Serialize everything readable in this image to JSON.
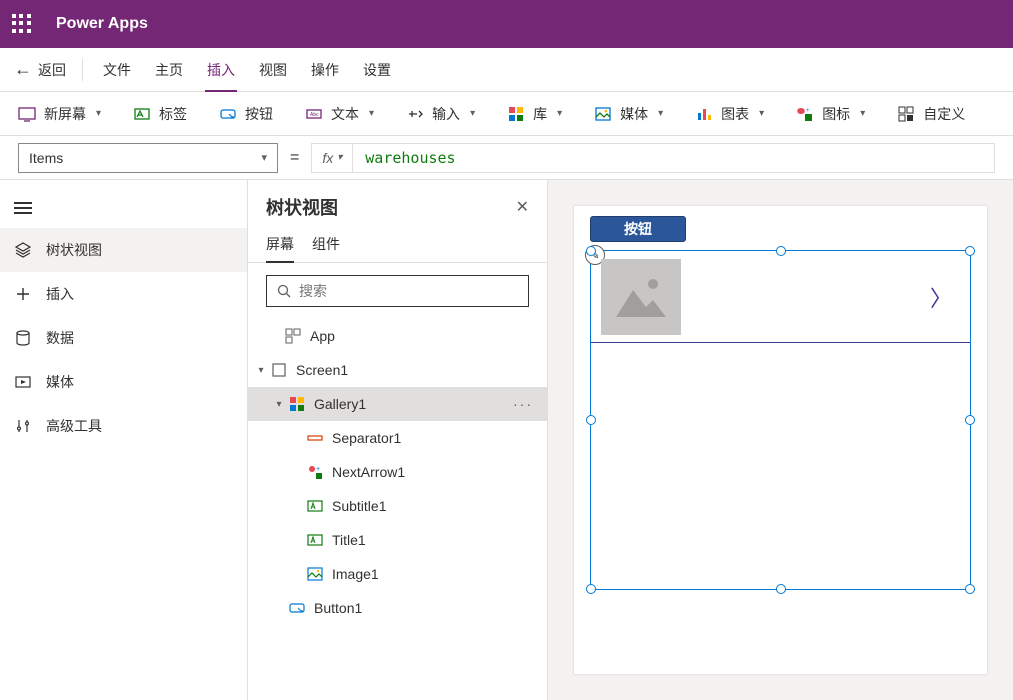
{
  "app_title": "Power Apps",
  "menubar": {
    "back": "返回",
    "items": [
      "文件",
      "主页",
      "插入",
      "视图",
      "操作",
      "设置"
    ],
    "active_index": 2
  },
  "ribbon": {
    "new_screen": "新屏幕",
    "label": "标签",
    "button": "按钮",
    "text": "文本",
    "input": "输入",
    "gallery": "库",
    "media": "媒体",
    "chart": "图表",
    "icon": "图标",
    "custom": "自定义"
  },
  "formula": {
    "property": "Items",
    "value": "warehouses"
  },
  "leftnav": {
    "items": [
      {
        "label": "树状视图",
        "icon": "layers-icon"
      },
      {
        "label": "插入",
        "icon": "plus-icon"
      },
      {
        "label": "数据",
        "icon": "database-icon"
      },
      {
        "label": "媒体",
        "icon": "media-icon"
      },
      {
        "label": "高级工具",
        "icon": "tools-icon"
      }
    ],
    "active_index": 0
  },
  "tree": {
    "title": "树状视图",
    "tabs": [
      "屏幕",
      "组件"
    ],
    "active_tab": 0,
    "search_placeholder": "搜索",
    "nodes": {
      "app": "App",
      "screen1": "Screen1",
      "gallery1": "Gallery1",
      "separator1": "Separator1",
      "nextarrow1": "NextArrow1",
      "subtitle1": "Subtitle1",
      "title1": "Title1",
      "image1": "Image1",
      "button1": "Button1"
    }
  },
  "canvas": {
    "button_text": "按钮"
  }
}
